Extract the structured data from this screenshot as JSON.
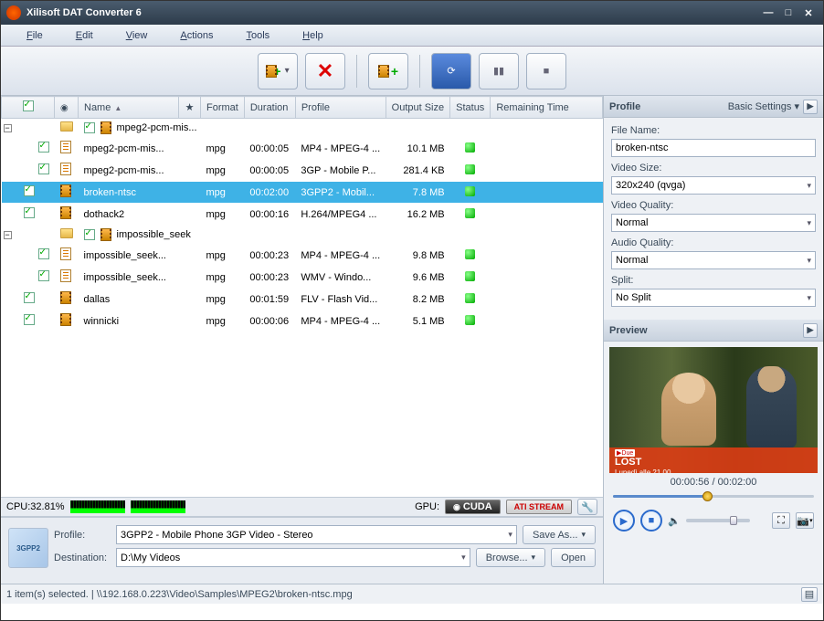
{
  "window": {
    "title": "Xilisoft DAT Converter 6"
  },
  "menu": [
    "File",
    "Edit",
    "View",
    "Actions",
    "Tools",
    "Help"
  ],
  "columns": {
    "name": "Name",
    "format": "Format",
    "duration": "Duration",
    "profile": "Profile",
    "output": "Output Size",
    "status": "Status",
    "remaining": "Remaining Time"
  },
  "rows": [
    {
      "type": "group",
      "expanded": true,
      "checked": true,
      "name": "mpeg2-pcm-mis...",
      "film": true
    },
    {
      "type": "item",
      "indent": 2,
      "checked": true,
      "name": "mpeg2-pcm-mis...",
      "format": "mpg",
      "duration": "00:00:05",
      "profile": "MP4 - MPEG-4 ...",
      "output": "10.1 MB",
      "status": true
    },
    {
      "type": "item",
      "indent": 2,
      "checked": true,
      "name": "mpeg2-pcm-mis...",
      "format": "mpg",
      "duration": "00:00:05",
      "profile": "3GP - Mobile P...",
      "output": "281.4 KB",
      "status": true
    },
    {
      "type": "item",
      "indent": 1,
      "checked": true,
      "selected": true,
      "film": true,
      "name": "broken-ntsc",
      "format": "mpg",
      "duration": "00:02:00",
      "profile": "3GPP2 - Mobil...",
      "output": "7.8 MB",
      "status": true
    },
    {
      "type": "item",
      "indent": 1,
      "checked": true,
      "film": true,
      "name": "dothack2",
      "format": "mpg",
      "duration": "00:00:16",
      "profile": "H.264/MPEG4 ...",
      "output": "16.2 MB",
      "status": true
    },
    {
      "type": "group",
      "expanded": true,
      "checked": true,
      "name": "impossible_seek",
      "film": true
    },
    {
      "type": "item",
      "indent": 2,
      "checked": true,
      "name": "impossible_seek...",
      "format": "mpg",
      "duration": "00:00:23",
      "profile": "MP4 - MPEG-4 ...",
      "output": "9.8 MB",
      "status": true
    },
    {
      "type": "item",
      "indent": 2,
      "checked": true,
      "name": "impossible_seek...",
      "format": "mpg",
      "duration": "00:00:23",
      "profile": "WMV - Windo...",
      "output": "9.6 MB",
      "status": true
    },
    {
      "type": "item",
      "indent": 1,
      "checked": true,
      "film": true,
      "name": "dallas",
      "format": "mpg",
      "duration": "00:01:59",
      "profile": "FLV - Flash Vid...",
      "output": "8.2 MB",
      "status": true
    },
    {
      "type": "item",
      "indent": 1,
      "checked": true,
      "film": true,
      "name": "winnicki",
      "format": "mpg",
      "duration": "00:00:06",
      "profile": "MP4 - MPEG-4 ...",
      "output": "5.1 MB",
      "status": true
    }
  ],
  "cpu": {
    "label": "CPU:32.81%",
    "gpu_label": "GPU:",
    "cuda": "CUDA",
    "ati": "ATI STREAM"
  },
  "bottom": {
    "profile_label": "Profile:",
    "profile_value": "3GPP2 - Mobile Phone 3GP Video - Stereo",
    "dest_label": "Destination:",
    "dest_value": "D:\\My Videos",
    "save_as": "Save As...",
    "browse": "Browse...",
    "open": "Open",
    "format_badge": "3GPP2"
  },
  "profile_panel": {
    "header": "Profile",
    "basic": "Basic Settings ▾",
    "filename_label": "File Name:",
    "filename": "broken-ntsc",
    "videosize_label": "Video Size:",
    "videosize": "320x240 (qvga)",
    "videoq_label": "Video Quality:",
    "videoq": "Normal",
    "audioq_label": "Audio Quality:",
    "audioq": "Normal",
    "split_label": "Split:",
    "split": "No Split"
  },
  "preview": {
    "header": "Preview",
    "banner_title": "LOST",
    "banner_sub": "Lunedì alle 21.00",
    "time": "00:00:56 / 00:02:00"
  },
  "status": "1 item(s) selected. | \\\\192.168.0.223\\Video\\Samples\\MPEG2\\broken-ntsc.mpg"
}
